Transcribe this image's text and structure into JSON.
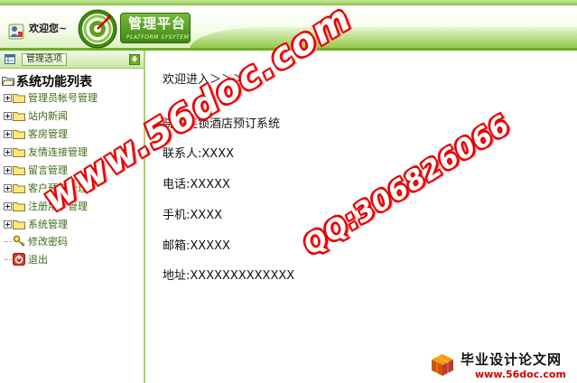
{
  "header": {
    "welcome": "欢迎您~",
    "logo_title": "管理平台",
    "logo_subtitle": "PLATFORM SYSYTEM"
  },
  "sidebar": {
    "options_tab": "管理选项",
    "root_label": "系统功能列表",
    "items": [
      {
        "label": "管理员帐号管理",
        "icon": "folder-icon"
      },
      {
        "label": "站内新闻",
        "icon": "folder-icon"
      },
      {
        "label": "客房管理",
        "icon": "folder-icon"
      },
      {
        "label": "友情连接管理",
        "icon": "folder-icon"
      },
      {
        "label": "留言管理",
        "icon": "folder-icon"
      },
      {
        "label": "客户预订管理",
        "icon": "folder-icon"
      },
      {
        "label": "注册用户管理",
        "icon": "folder-icon"
      },
      {
        "label": "系统管理",
        "icon": "folder-icon"
      }
    ],
    "leaves": [
      {
        "label": "修改密码",
        "icon": "key-icon"
      },
      {
        "label": "退出",
        "icon": "exit-icon"
      }
    ]
  },
  "main": {
    "breadcrumb": "欢迎进入＞＞＞",
    "system_name": "晓庄连锁酒店预订系统",
    "contact": "联系人:XXXX",
    "phone": "电话:XXXXX",
    "mobile": "手机:XXXX",
    "email": "邮箱:XXXXX",
    "address": "地址:XXXXXXXXXXXXX"
  },
  "watermark": {
    "site": "www.56doc.com",
    "qq": "QQ:306826066"
  },
  "footer": {
    "title": "毕业设计论文网",
    "url": "www.56doc.com"
  },
  "colors": {
    "brand_green": "#6fae2a",
    "link_green": "#3d6b17",
    "watermark_red": "#e60000"
  }
}
